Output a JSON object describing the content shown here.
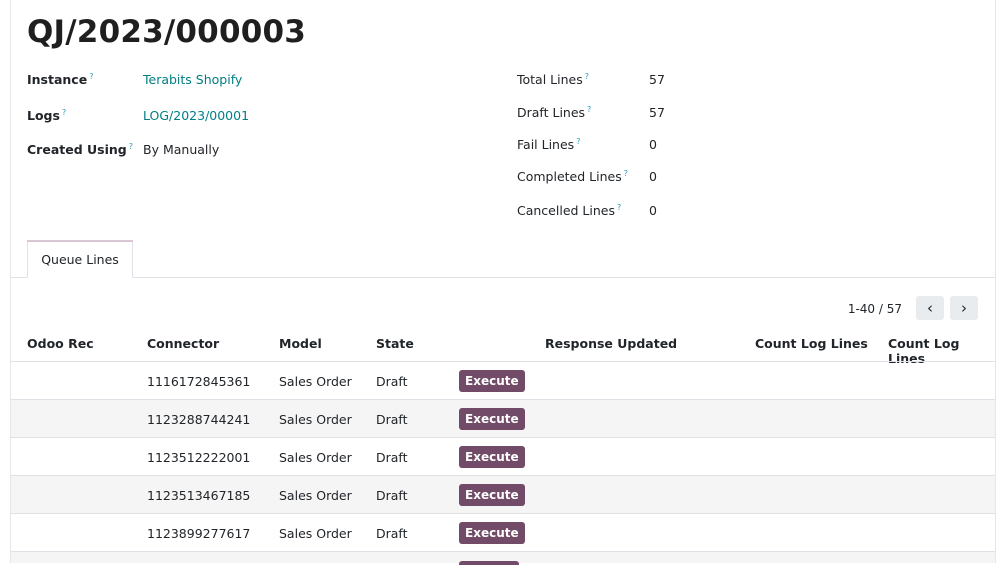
{
  "record": {
    "title": "QJ/2023/000003"
  },
  "left_fields": [
    {
      "label": "Instance",
      "value": "Terabits Shopify",
      "is_link": true
    },
    {
      "label": "Logs",
      "value": "LOG/2023/00001",
      "is_link": true
    },
    {
      "label": "Created Using",
      "value": "By Manually",
      "is_link": false
    }
  ],
  "right_fields": [
    {
      "label": "Total Lines",
      "value": "57"
    },
    {
      "label": "Draft Lines",
      "value": "57"
    },
    {
      "label": "Fail Lines",
      "value": "0"
    },
    {
      "label": "Completed Lines",
      "value": "0"
    },
    {
      "label": "Cancelled Lines",
      "value": "0"
    }
  ],
  "help_mark": "?",
  "tabs": [
    {
      "label": "Queue Lines",
      "active": true
    }
  ],
  "pager": {
    "range": "1-40 / 57",
    "prev": "‹",
    "next": "›"
  },
  "table": {
    "headers": [
      "Odoo Rec",
      "Connector",
      "Model",
      "State",
      "Response Updated",
      "Count Log Lines",
      "Count Log Lines"
    ],
    "rows": [
      {
        "connector": "1116172845361",
        "model": "Sales Order",
        "state": "Draft",
        "action": "Execute"
      },
      {
        "connector": "1123288744241",
        "model": "Sales Order",
        "state": "Draft",
        "action": "Execute"
      },
      {
        "connector": "1123512222001",
        "model": "Sales Order",
        "state": "Draft",
        "action": "Execute"
      },
      {
        "connector": "1123513467185",
        "model": "Sales Order",
        "state": "Draft",
        "action": "Execute"
      },
      {
        "connector": "1123899277617",
        "model": "Sales Order",
        "state": "Draft",
        "action": "Execute"
      }
    ]
  },
  "colors": {
    "accent": "#714b67",
    "link": "#017e84",
    "help": "#2d9bb7"
  }
}
